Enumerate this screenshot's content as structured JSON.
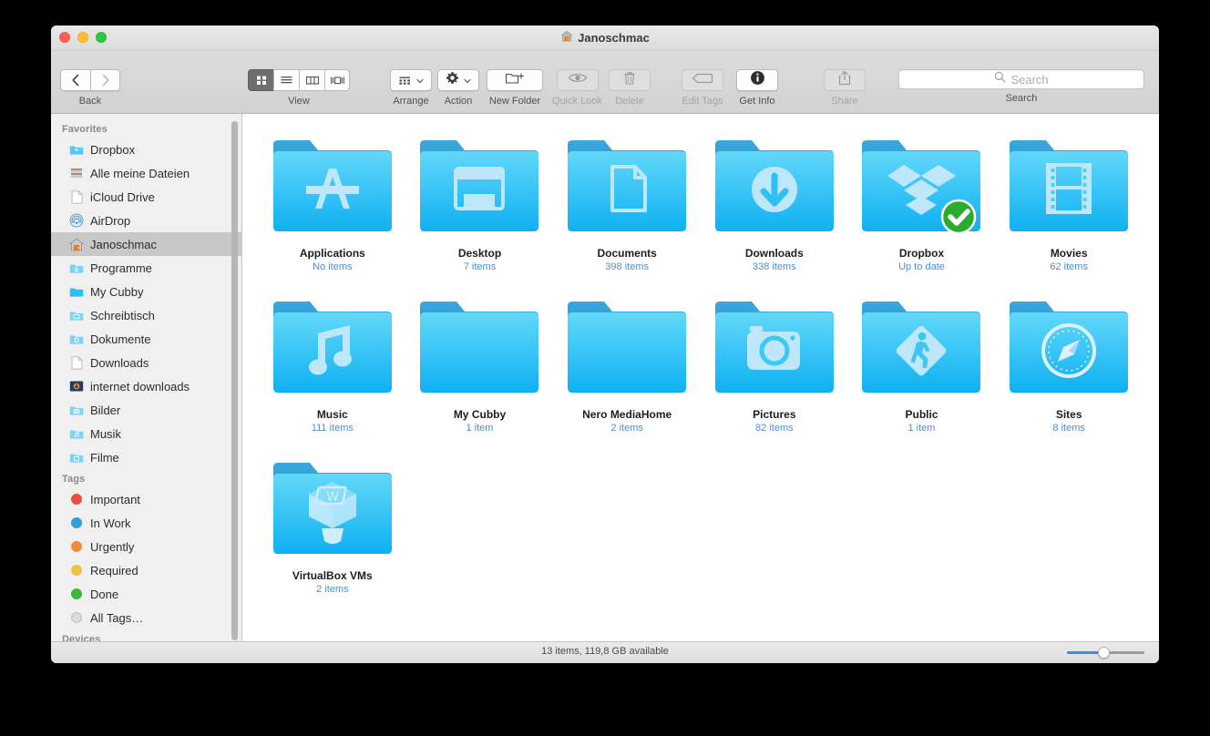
{
  "window": {
    "title": "Janoschmac",
    "title_icon": "home-icon",
    "traffic_lights": [
      "close",
      "minimize",
      "zoom"
    ]
  },
  "toolbar": {
    "back_forward_label": "Back",
    "view_label": "View",
    "view_modes": [
      {
        "name": "icon-view",
        "selected": true
      },
      {
        "name": "list-view",
        "selected": false
      },
      {
        "name": "column-view",
        "selected": false
      },
      {
        "name": "coverflow-view",
        "selected": false
      }
    ],
    "arrange_label": "Arrange",
    "action_label": "Action",
    "new_folder_label": "New Folder",
    "quick_look_label": "Quick Look",
    "delete_label": "Delete",
    "edit_tags_label": "Edit Tags",
    "get_info_label": "Get Info",
    "share_label": "Share",
    "search_label": "Search",
    "search_placeholder": "Search",
    "search_value": "",
    "disabled": [
      "Quick Look",
      "Delete",
      "Edit Tags",
      "Share"
    ]
  },
  "sidebar": {
    "sections": [
      {
        "header": "Favorites",
        "items": [
          {
            "label": "Dropbox",
            "icon": "dropbox-folder-icon",
            "selected": false
          },
          {
            "label": "Alle meine Dateien",
            "icon": "all-my-files-icon",
            "selected": false
          },
          {
            "label": "iCloud Drive",
            "icon": "icloud-drive-icon",
            "selected": false
          },
          {
            "label": "AirDrop",
            "icon": "airdrop-icon",
            "selected": false
          },
          {
            "label": "Janoschmac",
            "icon": "home-icon",
            "selected": true
          },
          {
            "label": "Programme",
            "icon": "applications-folder-icon",
            "selected": false
          },
          {
            "label": "My Cubby",
            "icon": "plain-folder-icon",
            "selected": false
          },
          {
            "label": "Schreibtisch",
            "icon": "desktop-folder-icon",
            "selected": false
          },
          {
            "label": "Dokumente",
            "icon": "documents-folder-icon",
            "selected": false
          },
          {
            "label": "Downloads",
            "icon": "downloads-file-icon",
            "selected": false
          },
          {
            "label": "internet downloads",
            "icon": "internet-downloads-icon",
            "selected": false
          },
          {
            "label": "Bilder",
            "icon": "pictures-folder-icon",
            "selected": false
          },
          {
            "label": "Musik",
            "icon": "music-folder-icon",
            "selected": false
          },
          {
            "label": "Filme",
            "icon": "movies-folder-icon",
            "selected": false
          }
        ]
      },
      {
        "header": "Tags",
        "items": [
          {
            "label": "Important",
            "icon": "tag-dot-icon",
            "color": "#ef4b40",
            "selected": false
          },
          {
            "label": "In Work",
            "icon": "tag-dot-icon",
            "color": "#2f9fe0",
            "selected": false
          },
          {
            "label": "Urgently",
            "icon": "tag-dot-icon",
            "color": "#ef8d3c",
            "selected": false
          },
          {
            "label": "Required",
            "icon": "tag-dot-icon",
            "color": "#ecc247",
            "selected": false
          },
          {
            "label": "Done",
            "icon": "tag-dot-icon",
            "color": "#3cb93c",
            "selected": false
          },
          {
            "label": "All Tags…",
            "icon": "all-tags-icon",
            "color": "#dcdcdc",
            "selected": false
          }
        ]
      },
      {
        "header": "Devices",
        "items": []
      }
    ]
  },
  "main": {
    "items": [
      {
        "name": "Applications",
        "sub": "No items",
        "icon": "applications-folder-icon",
        "badge": null
      },
      {
        "name": "Desktop",
        "sub": "7 items",
        "icon": "desktop-folder-icon",
        "badge": null
      },
      {
        "name": "Documents",
        "sub": "398 items",
        "icon": "documents-folder-icon",
        "badge": null
      },
      {
        "name": "Downloads",
        "sub": "338 items",
        "icon": "downloads-folder-icon",
        "badge": null
      },
      {
        "name": "Dropbox",
        "sub": "Up to date",
        "icon": "dropbox-folder-icon",
        "badge": "sync-check-badge"
      },
      {
        "name": "Movies",
        "sub": "62 items",
        "icon": "movies-folder-icon",
        "badge": null
      },
      {
        "name": "Music",
        "sub": "111 items",
        "icon": "music-folder-icon",
        "badge": null
      },
      {
        "name": "My Cubby",
        "sub": "1 item",
        "icon": "plain-folder-icon",
        "badge": null
      },
      {
        "name": "Nero MediaHome",
        "sub": "2 items",
        "icon": "plain-folder-icon",
        "badge": null
      },
      {
        "name": "Pictures",
        "sub": "82 items",
        "icon": "pictures-folder-icon",
        "badge": null
      },
      {
        "name": "Public",
        "sub": "1 item",
        "icon": "public-folder-icon",
        "badge": null
      },
      {
        "name": "Sites",
        "sub": "8 items",
        "icon": "sites-folder-icon",
        "badge": null
      },
      {
        "name": "VirtualBox VMs",
        "sub": "2 items",
        "icon": "virtualbox-folder-icon",
        "badge": null
      }
    ]
  },
  "statusbar": {
    "text": "13 items, 119,8 GB available",
    "zoom_slider_value": 42
  },
  "colors": {
    "accent": "#3c8ee0",
    "folder_top": "#5ed6f7",
    "folder_bottom": "#12a9ee",
    "sublabel": "#4b8ed6",
    "selection": "#c8c8c8"
  }
}
